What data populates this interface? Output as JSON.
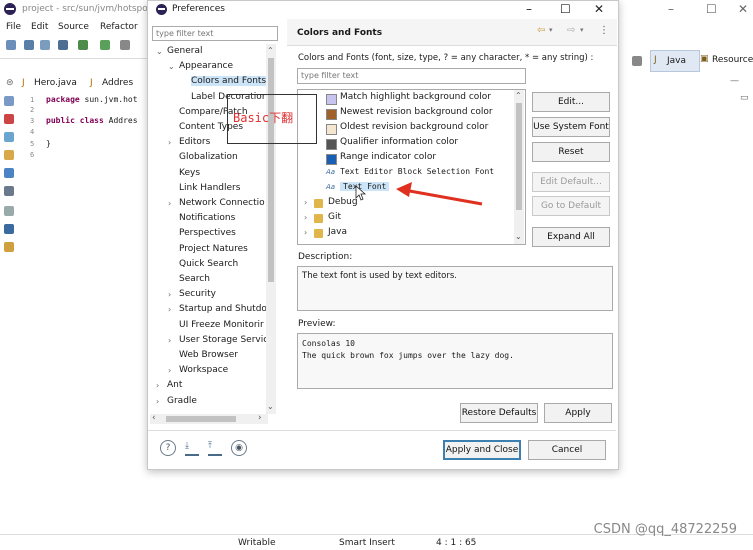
{
  "ide": {
    "window_title": "project - src/sun/jvm/hotspo",
    "menu": [
      "File",
      "Edit",
      "Source",
      "Refactor"
    ],
    "editor_tabs": [
      "Hero.java",
      "Addres"
    ],
    "line_numbers": [
      "1",
      "2",
      "3",
      "4",
      "5",
      "6"
    ],
    "code": {
      "line1_kw": "package",
      "line1_rest": "sun.jvm.hot",
      "line3_kw": "public class",
      "line3_rest": "Addres",
      "line5": "}"
    },
    "perspectives": [
      "Java",
      "Resource"
    ],
    "status": {
      "writable": "Writable",
      "insert": "Smart Insert",
      "position": "4 : 1 : 65"
    },
    "watermark": "CSDN @qq_48722259"
  },
  "dialog": {
    "title": "Preferences",
    "filter_placeholder": "type filter text",
    "tree": [
      {
        "label": "General",
        "level": 0,
        "state": "expanded"
      },
      {
        "label": "Appearance",
        "level": 1,
        "state": "expanded"
      },
      {
        "label": "Colors and Fonts",
        "level": 2,
        "state": "selected"
      },
      {
        "label": "Label Decoration",
        "level": 2,
        "state": "leaf"
      },
      {
        "label": "Compare/Patch",
        "level": 1,
        "state": "leaf"
      },
      {
        "label": "Content Types",
        "level": 1,
        "state": "leaf"
      },
      {
        "label": "Editors",
        "level": 1,
        "state": "collapsed"
      },
      {
        "label": "Globalization",
        "level": 1,
        "state": "leaf"
      },
      {
        "label": "Keys",
        "level": 1,
        "state": "leaf"
      },
      {
        "label": "Link Handlers",
        "level": 1,
        "state": "leaf"
      },
      {
        "label": "Network Connectio",
        "level": 1,
        "state": "collapsed"
      },
      {
        "label": "Notifications",
        "level": 1,
        "state": "leaf"
      },
      {
        "label": "Perspectives",
        "level": 1,
        "state": "leaf"
      },
      {
        "label": "Project Natures",
        "level": 1,
        "state": "leaf"
      },
      {
        "label": "Quick Search",
        "level": 1,
        "state": "leaf"
      },
      {
        "label": "Search",
        "level": 1,
        "state": "leaf"
      },
      {
        "label": "Security",
        "level": 1,
        "state": "collapsed"
      },
      {
        "label": "Startup and Shutdo",
        "level": 1,
        "state": "collapsed"
      },
      {
        "label": "UI Freeze Monitorir",
        "level": 1,
        "state": "leaf"
      },
      {
        "label": "User Storage Servic",
        "level": 1,
        "state": "collapsed"
      },
      {
        "label": "Web Browser",
        "level": 1,
        "state": "leaf"
      },
      {
        "label": "Workspace",
        "level": 1,
        "state": "collapsed"
      },
      {
        "label": "Ant",
        "level": 0,
        "state": "collapsed"
      },
      {
        "label": "Gradle",
        "level": 0,
        "state": "collapsed"
      }
    ],
    "page_title": "Colors and Fonts",
    "page_description": "Colors and Fonts (font, size, type, ? = any character, * = any string) :",
    "filter2_placeholder": "type filter text",
    "color_list": [
      {
        "label": "Match highlight background color",
        "kind": "color",
        "color": "#c8c4f0"
      },
      {
        "label": "Newest revision background color",
        "kind": "color",
        "color": "#a0622a"
      },
      {
        "label": "Oldest revision background color",
        "kind": "color",
        "color": "#f5e6d0"
      },
      {
        "label": "Qualifier information color",
        "kind": "color",
        "color": "#555555"
      },
      {
        "label": "Range indicator color",
        "kind": "color",
        "color": "#1a5fb4"
      },
      {
        "label": "Text Editor Block Selection Font",
        "kind": "font",
        "font_icon": "Aa"
      },
      {
        "label": "Text Font",
        "kind": "font",
        "font_icon": "Aa",
        "selected": true
      },
      {
        "label": "Debug",
        "kind": "folder"
      },
      {
        "label": "Git",
        "kind": "folder"
      },
      {
        "label": "Java",
        "kind": "folder"
      }
    ],
    "buttons": {
      "edit": "Edit...",
      "use_system_font": "Use System Font",
      "reset": "Reset",
      "edit_default": "Edit Default...",
      "go_to_default": "Go to Default",
      "expand_all": "Expand All",
      "restore_defaults": "Restore Defaults",
      "apply": "Apply",
      "apply_and_close": "Apply and Close",
      "cancel": "Cancel"
    },
    "description_label": "Description:",
    "description_text": "The text font is used by text editors.",
    "preview_label": "Preview:",
    "preview_line1": "Consolas 10",
    "preview_line2": "The quick brown fox jumps over the lazy dog.",
    "annotation": "Basic下翻",
    "accent_color": "#3c7fb1",
    "arrow_color": "#e03020"
  }
}
